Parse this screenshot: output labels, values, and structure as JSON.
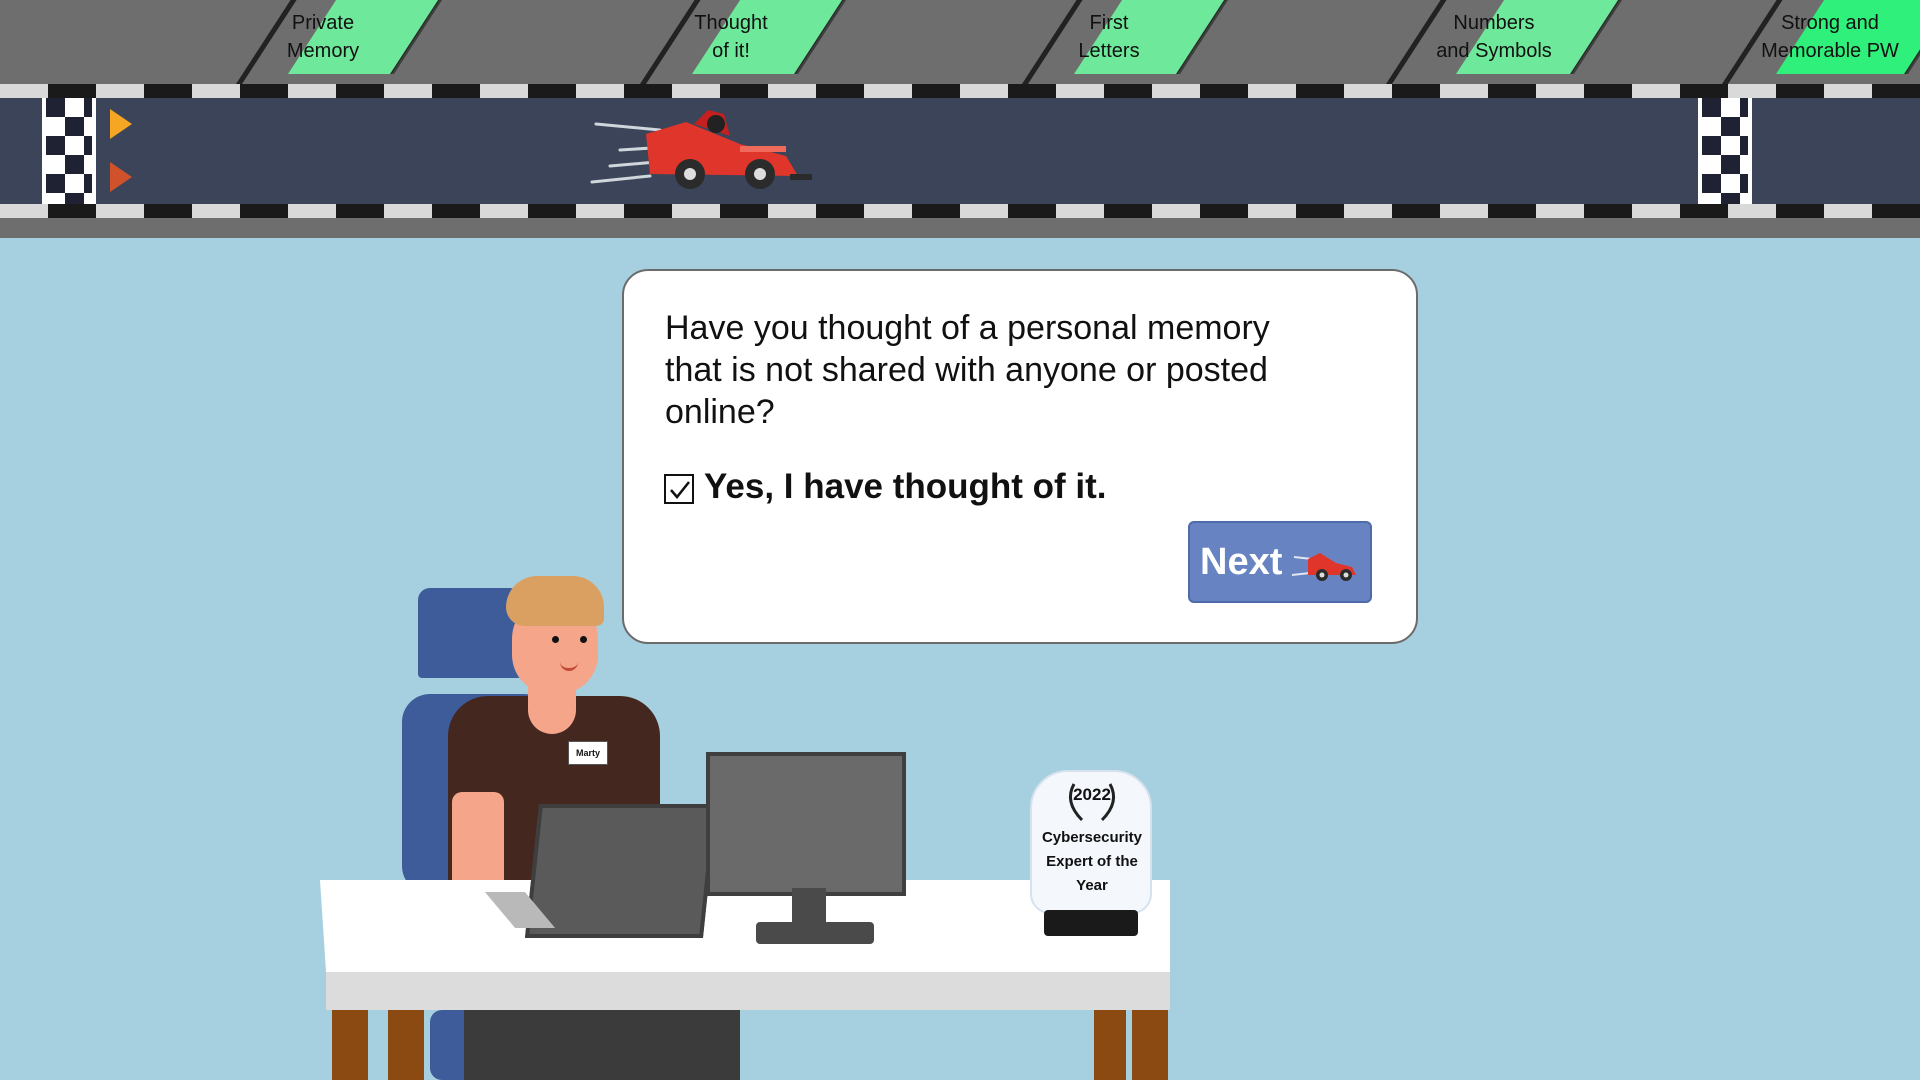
{
  "progress_steps": [
    {
      "label_line1": "Private",
      "label_line2": "Memory",
      "state": "done"
    },
    {
      "label_line1": "Thought",
      "label_line2": "of it!",
      "state": "done"
    },
    {
      "label_line1": "First",
      "label_line2": "Letters",
      "state": "done"
    },
    {
      "label_line1": "Numbers",
      "label_line2": "and Symbols",
      "state": "done"
    },
    {
      "label_line1": "Strong and",
      "label_line2": "Memorable PW",
      "state": "current"
    }
  ],
  "colors": {
    "background": "#a6d0e0",
    "flag": "#6ee89a",
    "flag_current": "#2ff07a",
    "road": "#3b4458",
    "next_button": "#6883c2",
    "race_car": "#e0352b"
  },
  "dialog": {
    "question": "Have you thought of a personal memory that is not shared with anyone or posted online?",
    "confirm_label": "Yes, I have thought of it.",
    "confirm_checked": true,
    "next_label": "Next"
  },
  "scene": {
    "nametag": "Marty",
    "trophy_year": "2022",
    "trophy_text": "Cybersecurity Expert of the Year"
  },
  "icons": [
    "race-car-icon",
    "checkmark-icon",
    "play-arrow-icon",
    "laurel-wreath-icon"
  ]
}
